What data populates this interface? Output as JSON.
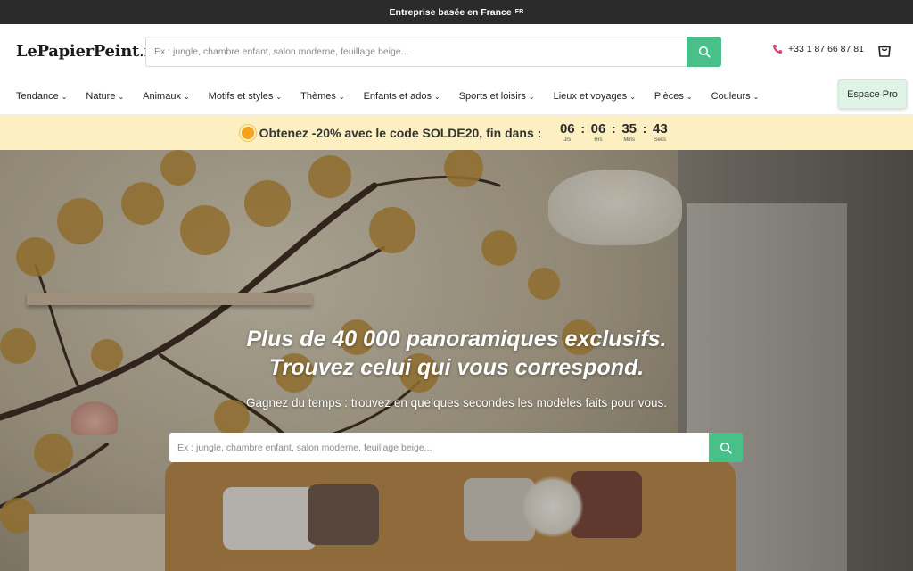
{
  "topbar": {
    "text": "Entreprise basée en France",
    "flag": "FR"
  },
  "header": {
    "logo_main": "LePapierPeint",
    "logo_tld": ".fr",
    "search_placeholder": "Ex : jungle, chambre enfant, salon moderne, feuillage beige...",
    "phone": "+33 1 87 66 87 81"
  },
  "nav": {
    "items": [
      {
        "label": "Tendance"
      },
      {
        "label": "Nature"
      },
      {
        "label": "Animaux"
      },
      {
        "label": "Motifs et styles"
      },
      {
        "label": "Thèmes"
      },
      {
        "label": "Enfants et ados"
      },
      {
        "label": "Sports et loisirs"
      },
      {
        "label": "Lieux et voyages"
      },
      {
        "label": "Pièces"
      },
      {
        "label": "Couleurs"
      }
    ],
    "pro_label": "Espace Pro"
  },
  "promo": {
    "text": "Obtenez -20% avec le code SOLDE20, fin dans :",
    "countdown": [
      {
        "value": "06",
        "label": "Jrs"
      },
      {
        "value": "06",
        "label": "Hrs"
      },
      {
        "value": "35",
        "label": "Mins"
      },
      {
        "value": "43",
        "label": "Secs"
      }
    ]
  },
  "hero": {
    "title_line1": "Plus de 40 000 panoramiques exclusifs.",
    "title_line2": "Trouvez celui qui vous correspond.",
    "subtitle": "Gagnez du temps : trouvez en quelques secondes les modèles faits pour vous.",
    "search_placeholder": "Ex : jungle, chambre enfant, salon moderne, feuillage beige..."
  },
  "colors": {
    "accent_green": "#49c089",
    "promo_bg": "#fcefc1",
    "topbar_bg": "#2b2b2b"
  },
  "icons": {
    "search": "search-icon",
    "phone": "phone-icon",
    "cart": "shopping-bag-icon",
    "promo": "sun-icon"
  }
}
